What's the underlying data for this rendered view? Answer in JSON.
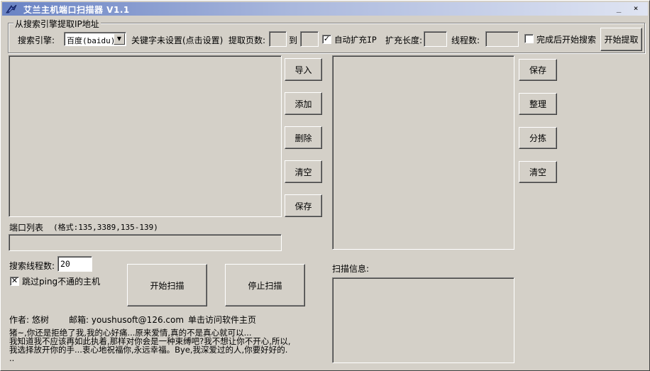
{
  "window": {
    "title": "艾兰主机端口扫描器 V1.1",
    "minimize_glyph": "_",
    "close_glyph": "×"
  },
  "search_group": {
    "title": "从搜索引擎提取IP地址",
    "engine_label": "搜索引擎:",
    "engine_selected": "百度(baidu)",
    "keyword_label": "关键字未设置(点击设置)",
    "pages_label": "提取页数:",
    "pages_from": "",
    "to_label": "到",
    "pages_to": "",
    "auto_expand_checked": true,
    "auto_expand_label": "自动扩充IP",
    "expand_length_label": "扩充长度:",
    "expand_length": "",
    "threads_label": "线程数:",
    "threads_value": "",
    "start_after_checked": false,
    "start_after_label": "完成后开始搜索",
    "start_extract_label": "开始提取"
  },
  "left_buttons": {
    "import": "导入",
    "add": "添加",
    "delete": "删除",
    "clear": "清空",
    "save": "保存"
  },
  "right_buttons": {
    "save": "保存",
    "organize": "整理",
    "sort": "分拣",
    "clear": "清空"
  },
  "port_list": {
    "label": "端口列表",
    "format_hint": "(格式:135,3389,135-139)",
    "value": ""
  },
  "scan": {
    "threads_label": "搜索线程数:",
    "threads_value": "20",
    "skip_ping_checked": true,
    "skip_ping_label": "跳过ping不通的主机",
    "start_label": "开始扫描",
    "stop_label": "停止扫描",
    "info_label": "扫描信息:"
  },
  "footer": {
    "author": "作者: 悠树",
    "email": "邮箱: youshusoft@126.com",
    "homepage": "单击访问软件主页",
    "message_lines": [
      "猪~,你还是拒绝了我,我的心好痛...原来爱情,真的不是真心就可以...",
      "我知道我不应该再如此执着,那样对你会是一种束缚吧?我不想让你不开心,所以,",
      "我选择放开你的手...衷心地祝福你,永远幸福。Bye,我深爱过的人,你要好好的.",
      ".."
    ]
  }
}
